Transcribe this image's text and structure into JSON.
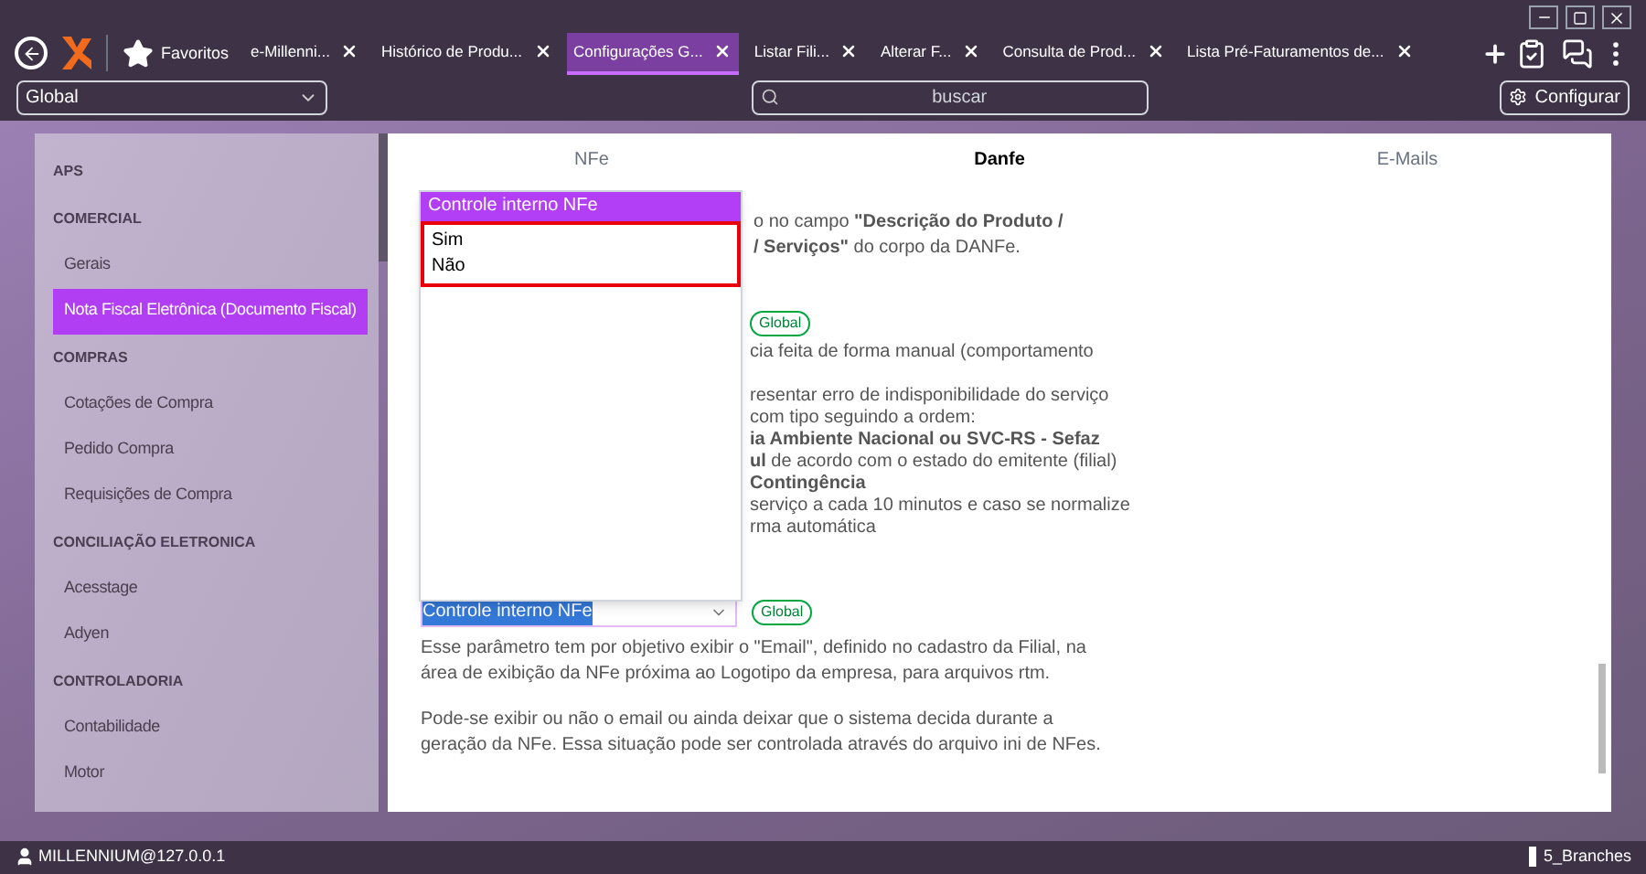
{
  "toolbar": {
    "favorites": "Favoritos"
  },
  "tabs": [
    {
      "label": "e-Millenni...",
      "selected": false
    },
    {
      "label": "Histórico de Produ...",
      "selected": false
    },
    {
      "label": "Configurações G...",
      "selected": true
    },
    {
      "label": "Listar Fili...",
      "selected": false
    },
    {
      "label": "Alterar F...",
      "selected": false
    },
    {
      "label": "Consulta de Prod...",
      "selected": false
    },
    {
      "label": "Lista Pré-Faturamentos de...",
      "selected": false
    }
  ],
  "scope_select": {
    "value": "Global"
  },
  "search": {
    "placeholder": "buscar"
  },
  "configure_button": "Configurar",
  "sidebar": {
    "items": [
      {
        "kind": "header",
        "label": "APS"
      },
      {
        "kind": "header",
        "label": "COMERCIAL"
      },
      {
        "kind": "item",
        "label": "Gerais",
        "selected": false
      },
      {
        "kind": "item",
        "label": "Nota Fiscal Eletrônica (Documento Fiscal)",
        "selected": true
      },
      {
        "kind": "header",
        "label": "COMPRAS"
      },
      {
        "kind": "item",
        "label": "Cotações de Compra",
        "selected": false
      },
      {
        "kind": "item",
        "label": "Pedido Compra",
        "selected": false
      },
      {
        "kind": "item",
        "label": "Requisições de Compra",
        "selected": false
      },
      {
        "kind": "header",
        "label": "CONCILIAÇÃO ELETRONICA"
      },
      {
        "kind": "item",
        "label": "Acesstage",
        "selected": false
      },
      {
        "kind": "item",
        "label": "Adyen",
        "selected": false
      },
      {
        "kind": "header",
        "label": "CONTROLADORIA"
      },
      {
        "kind": "item",
        "label": "Contabilidade",
        "selected": false
      },
      {
        "kind": "item",
        "label": "Motor",
        "selected": false
      }
    ]
  },
  "content_tabs": [
    {
      "label": "NFe",
      "selected": false
    },
    {
      "label": "Danfe",
      "selected": true
    },
    {
      "label": "E-Mails",
      "selected": false
    }
  ],
  "partial_text": {
    "block_1": [
      "o no campo **\"Descrição do Produto /**",
      "**/ Serviços\"** do corpo da DANFe."
    ],
    "badge_1": "Global",
    "block_2": [
      "cia feita de forma manual (comportamento"
    ],
    "block_3": [
      "resentar erro de indisponibilidade do serviço",
      "com tipo seguindo a ordem:",
      "**ia Ambiente Nacional ou SVC-RS - Sefaz**",
      "**ul** de acordo com o estado do emitente (filial)",
      "**Contingência**",
      "serviço a cada 10 minutos e caso se normalize",
      "rma automática"
    ]
  },
  "setting": {
    "value": "Controle interno NFe",
    "badge": "Global",
    "paragraphs": [
      "Esse parâmetro tem por objetivo exibir o \"Email\", definido no cadastro da Filial, na área de exibição da NFe próxima ao Logotipo da empresa, para arquivos rtm.",
      "Pode-se exibir ou não o email ou ainda deixar que o sistema decida durante a geração da NFe. Essa situação pode ser controlada através do arquivo ini de NFes."
    ]
  },
  "dropdown": {
    "header": "Controle interno NFe",
    "options": [
      "Sim",
      "Não"
    ]
  },
  "status_bar": {
    "user": "MILLENNIUM@127.0.0.1",
    "branch": "5_Branches"
  }
}
